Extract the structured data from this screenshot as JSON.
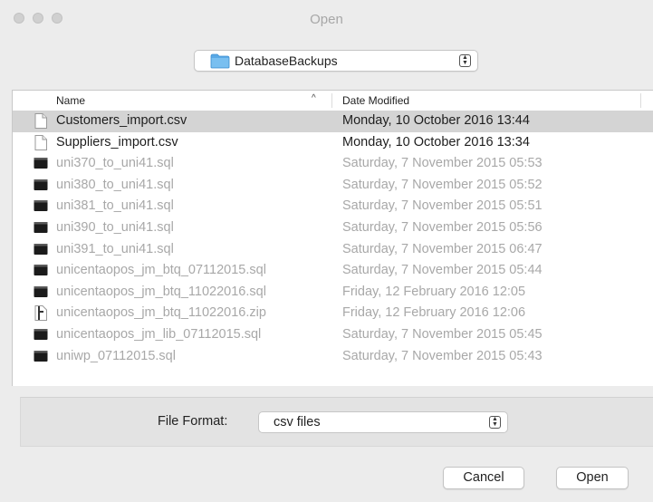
{
  "window": {
    "title": "Open"
  },
  "location": {
    "folder": "DatabaseBackups"
  },
  "columns": {
    "name": "Name",
    "date_modified": "Date Modified"
  },
  "files": [
    {
      "name": "Customers_import.csv",
      "date": "Monday, 10 October 2016 13:44"
    },
    {
      "name": "Suppliers_import.csv",
      "date": "Monday, 10 October 2016 13:34"
    },
    {
      "name": "uni370_to_uni41.sql",
      "date": "Saturday, 7 November 2015 05:53"
    },
    {
      "name": "uni380_to_uni41.sql",
      "date": "Saturday, 7 November 2015 05:52"
    },
    {
      "name": "uni381_to_uni41.sql",
      "date": "Saturday, 7 November 2015 05:51"
    },
    {
      "name": "uni390_to_uni41.sql",
      "date": "Saturday, 7 November 2015 05:56"
    },
    {
      "name": "uni391_to_uni41.sql",
      "date": "Saturday, 7 November 2015 06:47"
    },
    {
      "name": "unicentaopos_jm_btq_07112015.sql",
      "date": "Saturday, 7 November 2015 05:44"
    },
    {
      "name": "unicentaopos_jm_btq_11022016.sql",
      "date": "Friday, 12 February 2016 12:05"
    },
    {
      "name": "unicentaopos_jm_btq_11022016.zip",
      "date": "Friday, 12 February 2016 12:06"
    },
    {
      "name": "unicentaopos_jm_lib_07112015.sql",
      "date": "Saturday, 7 November 2015 05:45"
    },
    {
      "name": "uniwp_07112015.sql",
      "date": "Saturday, 7 November 2015 05:43"
    }
  ],
  "format": {
    "label": "File Format:",
    "value": "csv files"
  },
  "buttons": {
    "cancel": "Cancel",
    "open": "Open"
  }
}
